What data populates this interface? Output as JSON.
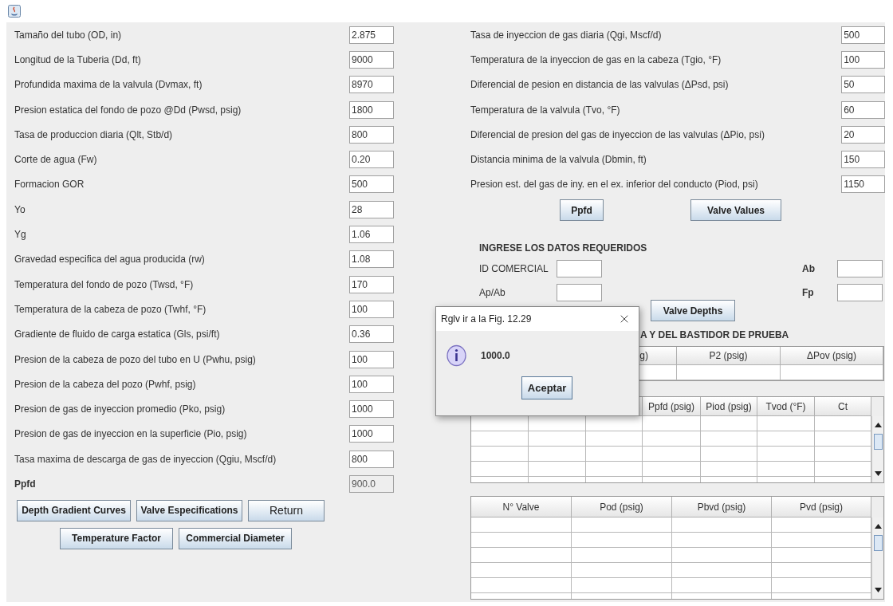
{
  "left_fields": [
    {
      "label": "Tamaño del tubo (OD, in)",
      "value": "2.875"
    },
    {
      "label": "Longitud de la Tuberia (Dd, ft)",
      "value": "9000"
    },
    {
      "label": "Profundida maxima de la valvula (Dvmax, ft)",
      "value": "8970"
    },
    {
      "label": "Presion estatica del fondo de pozo @Dd (Pwsd, psig)",
      "value": "1800"
    },
    {
      "label": "Tasa de produccion diaria (Qlt, Stb/d)",
      "value": "800"
    },
    {
      "label": "Corte de agua (Fw)",
      "value": "0.20"
    },
    {
      "label": "Formacion GOR",
      "value": "500"
    },
    {
      "label": "Yo",
      "value": "28"
    },
    {
      "label": "Yg",
      "value": "1.06"
    },
    {
      "label": "Gravedad especifica del agua producida (rw)",
      "value": "1.08"
    },
    {
      "label": "Temperatura del fondo de pozo (Twsd, °F)",
      "value": "170"
    },
    {
      "label": "Temperatura de la cabeza de pozo (Twhf, °F)",
      "value": "100"
    },
    {
      "label": "Gradiente de fluido de carga estatica (Gls, psi/ft)",
      "value": "0.36"
    },
    {
      "label": "Presion de la cabeza de pozo del tubo en U (Pwhu, psig)",
      "value": "100"
    },
    {
      "label": "Presion de la cabeza del pozo (Pwhf, psig)",
      "value": "100"
    },
    {
      "label": "Presion de gas de inyeccion promedio (Pko, psig)",
      "value": "1000"
    },
    {
      "label": "Presion de gas de inyeccion en la superficie (Pio, psig)",
      "value": "1000"
    },
    {
      "label": "Tasa maxima de descarga de gas de inyeccion (Qgiu, Mscf/d)",
      "value": "800"
    }
  ],
  "ppfd": {
    "label": "Ppfd",
    "value": "900.0",
    "disabled": true
  },
  "left_buttons": [
    [
      {
        "label": "Depth Gradient Curves",
        "bold": true
      },
      {
        "label": "Valve Especifications",
        "bold": true
      },
      {
        "label": "Return",
        "bold": false
      }
    ],
    [
      {
        "label": "Temperature Factor",
        "bold": true
      },
      {
        "label": "Commercial Diameter",
        "bold": true
      }
    ]
  ],
  "right_fields": [
    {
      "label": "Tasa de inyeccion de gas diaria (Qgi, Mscf/d)",
      "value": "500"
    },
    {
      "label": "Temperatura de la inyeccion de gas en la cabeza (Tgio, °F)",
      "value": "100"
    },
    {
      "label": "Diferencial de pesion en distancia de las valvulas (ΔPsd, psi)",
      "value": "50"
    },
    {
      "label": "Temperatura de la valvula (Tvo, °F)",
      "value": "60"
    },
    {
      "label": "Diferencial de presion del gas de inyeccion de las valvulas (ΔPio, psi)",
      "value": "20"
    },
    {
      "label": "Distancia minima de la valvula (Dbmin, ft)",
      "value": "150"
    },
    {
      "label": "Presion est. del gas de iny. en el ex. inferior del conducto (Piod, psi)",
      "value": "1150"
    }
  ],
  "right_buttons": [
    "Ppfd",
    "Valve Values"
  ],
  "required": {
    "title": "INGRESE LOS DATOS REQUERIDOS",
    "fields": [
      {
        "label": "ID COMERCIAL"
      },
      {
        "label": "Ab"
      },
      {
        "label": "Ap/Ab"
      },
      {
        "label": "Fp"
      }
    ],
    "button": "Valve Depths"
  },
  "section_title": "A Y DEL BASTIDOR DE PRUEBA",
  "table_1": {
    "columns": [
      "g)",
      "P2 (psig)",
      "ΔPov (psig)"
    ]
  },
  "table_2": {
    "columns": [
      "Ppfd (psig)",
      "Piod (psig)",
      "Tvod (°F)",
      "Ct"
    ]
  },
  "table_3": {
    "columns": [
      "N° Valve",
      "Pod (psig)",
      "Pbvd (psig)",
      "Pvd (psig)"
    ]
  },
  "dialog": {
    "title": "Rglv ir a la Fig. 12.29",
    "message": "1000.0",
    "button": "Aceptar"
  }
}
